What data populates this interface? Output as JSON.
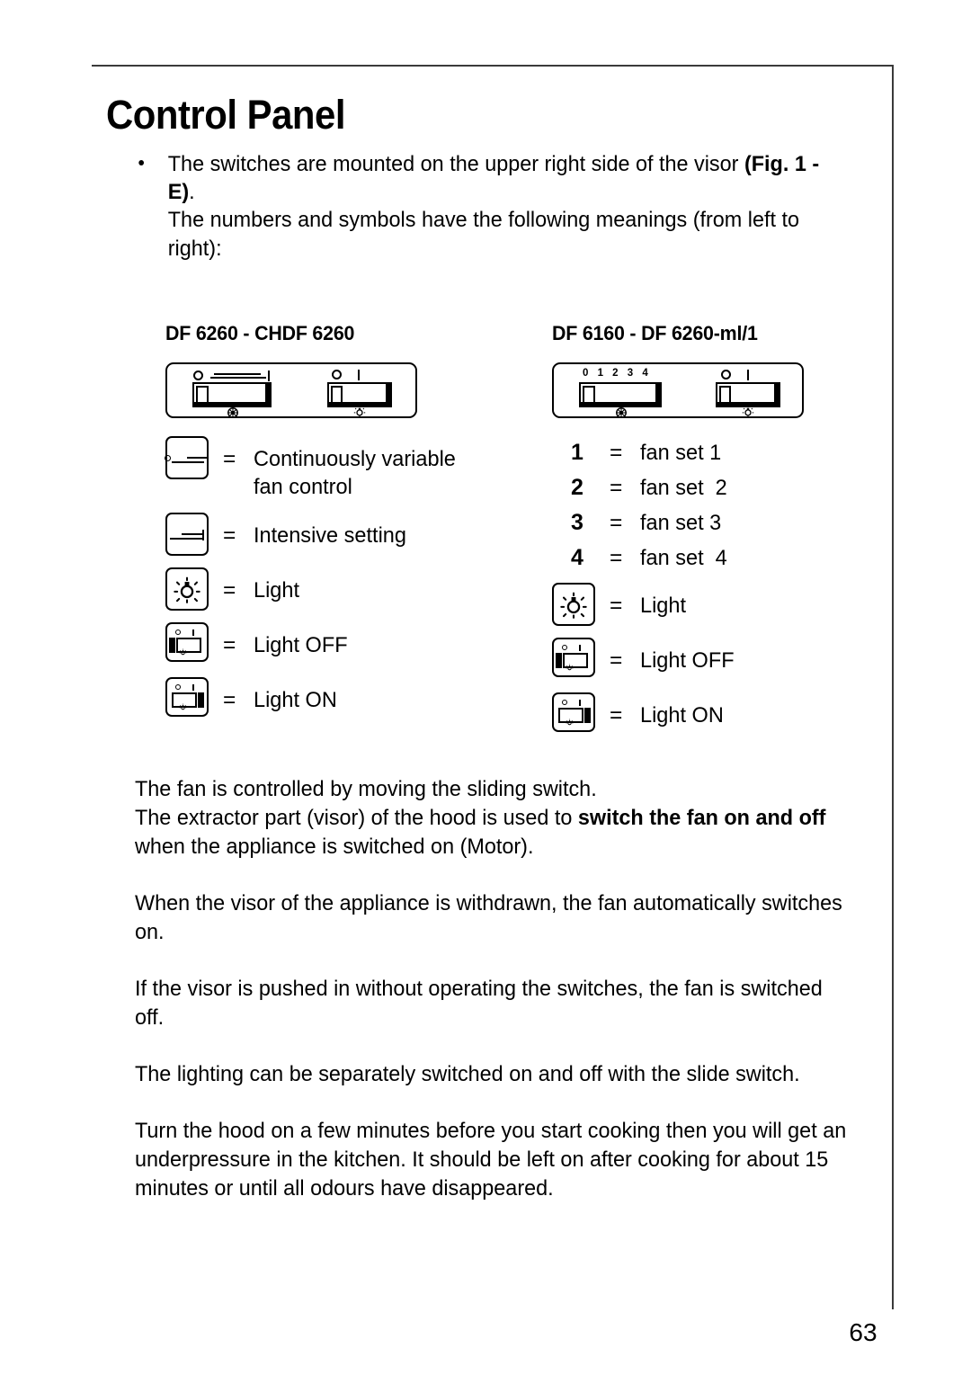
{
  "page": {
    "title": "Control Panel",
    "number": "63"
  },
  "intro": {
    "bullet_line1_a": "The switches are mounted on the upper right side of the visor ",
    "bullet_line1_b": "(Fig. 1 - E)",
    "bullet_line1_c": ".",
    "bullet_line2": "The numbers and symbols have the following meanings (from left to right):"
  },
  "columns": {
    "left": {
      "model_heading": "DF 6260 - CHDF 6260",
      "panel": {
        "name": "control-panel-df6260",
        "left_switch_scale": "",
        "left_switch_markers": [
          "o",
          "dashes"
        ],
        "right_switch_markers": [
          "O",
          "I"
        ],
        "fan_icon": "fan-icon",
        "lamp_icon": "lamp-icon"
      },
      "rows": [
        {
          "icon": "continuously-variable-fan-icon",
          "eq": "=",
          "label": "Continuously variable\nfan control"
        },
        {
          "icon": "intensive-setting-icon",
          "eq": "=",
          "label": "Intensive setting"
        },
        {
          "icon": "light-icon",
          "eq": "=",
          "label": "Light"
        },
        {
          "icon": "light-off-switch-icon",
          "eq": "=",
          "label": "Light OFF"
        },
        {
          "icon": "light-on-switch-icon",
          "eq": "=",
          "label": "Light ON"
        }
      ]
    },
    "right": {
      "model_heading": "DF 6160  -  DF 6260-ml/1",
      "panel": {
        "name": "control-panel-df6160",
        "left_switch_scale": "0 1 2 3 4",
        "right_switch_markers": [
          "O",
          "i"
        ],
        "fan_icon": "fan-icon",
        "lamp_icon": "lamp-icon"
      },
      "number_rows": [
        {
          "num": "1",
          "eq": "=",
          "label": "fan set 1"
        },
        {
          "num": "2",
          "eq": "=",
          "label": "fan set  2"
        },
        {
          "num": "3",
          "eq": "=",
          "label": "fan set 3"
        },
        {
          "num": "4",
          "eq": "=",
          "label": "fan set  4"
        }
      ],
      "rows": [
        {
          "icon": "light-icon",
          "eq": "=",
          "label": "Light"
        },
        {
          "icon": "light-off-switch-icon",
          "eq": "=",
          "label": "Light OFF"
        },
        {
          "icon": "light-on-switch-icon",
          "eq": "=",
          "label": "Light ON"
        }
      ]
    }
  },
  "body": {
    "p1_line1": "The fan is controlled by moving the sliding switch.",
    "p1_line2_a": "The extractor part (visor) of the hood is used to ",
    "p1_line2_b": "switch the fan on and off",
    "p1_line2_c": " when the appliance is switched on (Motor).",
    "p2": "When the visor of the appliance is withdrawn, the fan automatically switches on.",
    "p3": "If the visor is pushed in without operating the switches, the fan is switched off.",
    "p4": "The lighting can be separately switched on and off with the slide switch.",
    "p5": "Turn the hood on a few minutes before you start cooking then you will get an underpressure in the kitchen. It should be left on after cooking for about 15 minutes or until all odours have disappeared."
  }
}
